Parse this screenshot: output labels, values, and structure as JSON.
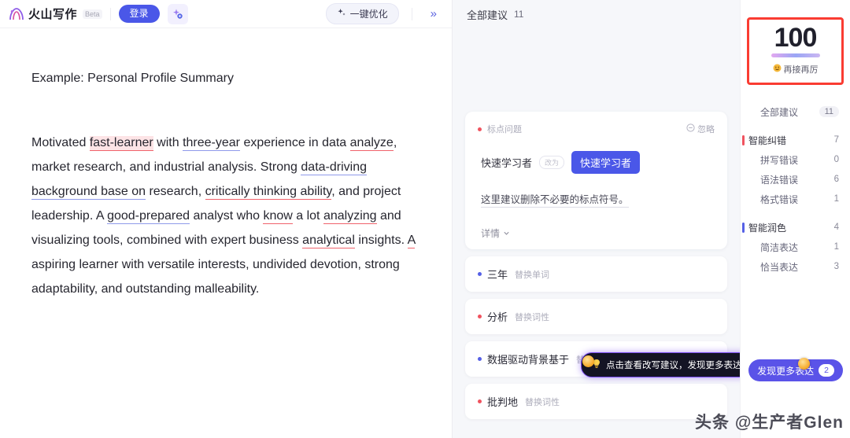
{
  "header": {
    "brand_name": "火山写作",
    "beta_tag": "Beta",
    "login_label": "登录",
    "magic_icon": "sparkle-gear-icon",
    "optimize_label": "一键优化",
    "optimize_icon": "sparkle-icon",
    "collapse_icon": "chevron-double-right-icon"
  },
  "document": {
    "title": "Example: Personal Profile Summary",
    "paragraph": [
      {
        "text": "Motivated ",
        "style": "plain"
      },
      {
        "text": "fast-learner",
        "style": "error-highlight"
      },
      {
        "text": " with ",
        "style": "plain"
      },
      {
        "text": "three-year",
        "style": "polish"
      },
      {
        "text": " experience in data ",
        "style": "plain"
      },
      {
        "text": "analyze",
        "style": "error"
      },
      {
        "text": ", market research, and industrial analysis. Strong ",
        "style": "plain"
      },
      {
        "text": "data-driving background base on",
        "style": "polish"
      },
      {
        "text": " research, ",
        "style": "plain"
      },
      {
        "text": "critically thinking ability",
        "style": "error"
      },
      {
        "text": ", and project leadership. A ",
        "style": "plain"
      },
      {
        "text": "good-prepared",
        "style": "polish"
      },
      {
        "text": " analyst who ",
        "style": "plain"
      },
      {
        "text": "know",
        "style": "error"
      },
      {
        "text": " a lot ",
        "style": "plain"
      },
      {
        "text": "analyzing",
        "style": "error"
      },
      {
        "text": " and visualizing tools, combined with expert business ",
        "style": "plain"
      },
      {
        "text": "analytical",
        "style": "error"
      },
      {
        "text": " insights. ",
        "style": "plain"
      },
      {
        "text": "A",
        "style": "error"
      },
      {
        "text": " aspiring learner with versatile interests, undivided devotion, strong adaptability, and outstanding malleability.",
        "style": "plain"
      }
    ]
  },
  "suggestions": {
    "header_label": "全部建议",
    "header_count": "11",
    "card": {
      "type_label": "标点问题",
      "dot_color": "red",
      "ignore_label": "忽略",
      "ignore_icon": "minus-circle-icon",
      "original_text": "快速学习者",
      "arrow_label": "改为",
      "replacement_text": "快速学习者",
      "description": "这里建议删除不必要的标点符号。",
      "detail_label": "详情",
      "detail_icon": "chevron-down-icon"
    },
    "items": [
      {
        "word": "三年",
        "tag": "替换单词",
        "dot_color": "blue"
      },
      {
        "word": "分析",
        "tag": "替换词性",
        "dot_color": "red"
      },
      {
        "word": "数据驱动背景基于",
        "tag": "替换词性",
        "dot_color": "blue"
      },
      {
        "word": "批判地",
        "tag": "替换词性",
        "dot_color": "red"
      }
    ],
    "tooltip": {
      "text": "点击查看改写建议，发现更多表达",
      "icon": "lightbulb-icon"
    }
  },
  "score": {
    "value": "100",
    "label": "再接再厉",
    "label_icon": "smiley-icon",
    "highlight_color": "#fa3c32"
  },
  "nav": {
    "all_label": "全部建议",
    "all_count": "11",
    "groups": [
      {
        "label": "智能纠错",
        "count": "7",
        "accent": "#f0535f",
        "children": [
          {
            "label": "拼写错误",
            "count": "0"
          },
          {
            "label": "语法错误",
            "count": "6"
          },
          {
            "label": "格式错误",
            "count": "1"
          }
        ]
      },
      {
        "label": "智能润色",
        "count": "4",
        "accent": "#5560e6",
        "children": [
          {
            "label": "简洁表达",
            "count": "1"
          },
          {
            "label": "恰当表达",
            "count": "3"
          }
        ]
      }
    ],
    "discover_label": "发现更多表达",
    "discover_count": "2"
  },
  "watermark": {
    "text": "头条 @生产者Glen"
  }
}
